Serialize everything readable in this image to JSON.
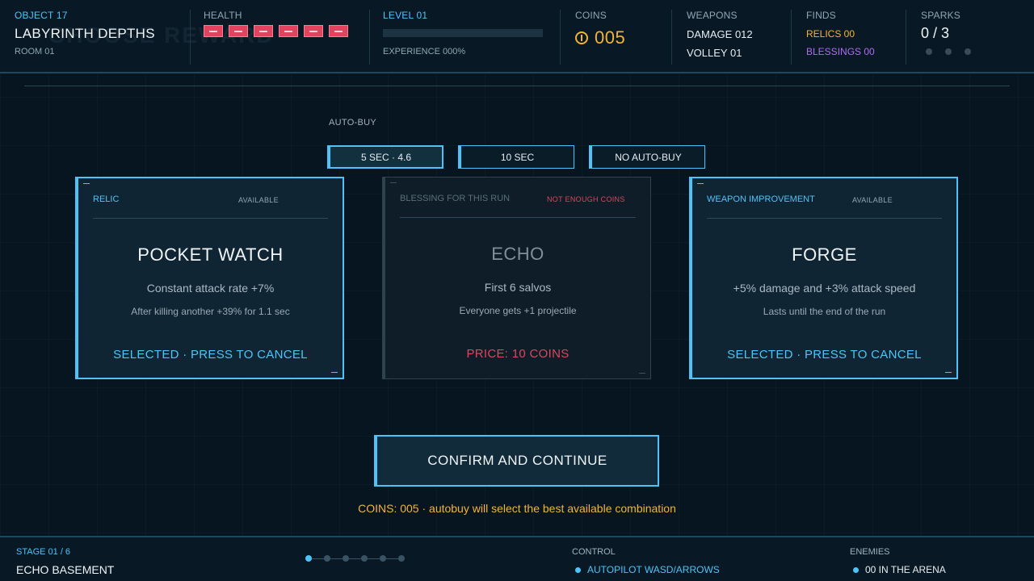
{
  "colors": {
    "accent": "#4fc3f7",
    "coin": "#f5b335",
    "danger": "#e0445e",
    "blessing": "#b06cf0",
    "background": "#071520"
  },
  "hud": {
    "object": {
      "label": "OBJECT 17",
      "title": "LABYRINTH DEPTHS",
      "room": "ROOM 01"
    },
    "health": {
      "label": "HEALTH",
      "pips": 6,
      "icon": "health-pip-icon"
    },
    "level": {
      "label": "LEVEL 01",
      "xp_fraction": 0.0,
      "xp_label": "EXPERIENCE 000%"
    },
    "coins": {
      "label": "COINS",
      "value": "005",
      "icon": "coin-icon"
    },
    "weapons": {
      "label": "WEAPONS",
      "damage": "DAMAGE 012",
      "volley": "VOLLEY 01"
    },
    "finds": {
      "label": "FINDS",
      "relics": "RELICS 00",
      "blessings": "BLESSINGS 00"
    },
    "sparks": {
      "label": "SPARKS",
      "value": "0 / 3",
      "filled": 0,
      "total": 3
    }
  },
  "autobuy": {
    "label": "AUTO-BUY",
    "options": [
      {
        "label": "5 SEC · 4.6",
        "active": true
      },
      {
        "label": "10 SEC",
        "active": false
      },
      {
        "label": "NO AUTO-BUY",
        "active": false
      }
    ]
  },
  "cards": [
    {
      "type": "RELIC",
      "status": "AVAILABLE",
      "title": "POCKET WATCH",
      "desc1": "Constant attack rate +7%",
      "desc2": "After killing another +39% for 1.1 sec",
      "action": "SELECTED · PRESS TO CANCEL",
      "disabled": false
    },
    {
      "type": "BLESSING FOR THIS RUN",
      "status": "NOT ENOUGH COINS",
      "title": "ECHO",
      "desc1": "First 6 salvos",
      "desc2": "Everyone gets +1 projectile",
      "action": "PRICE: 10 COINS",
      "disabled": true
    },
    {
      "type": "WEAPON IMPROVEMENT",
      "status": "AVAILABLE",
      "title": "FORGE",
      "desc1": "+5% damage and +3% attack speed",
      "desc2": "Lasts until the end of the run",
      "action": "SELECTED · PRESS TO CANCEL",
      "disabled": false
    }
  ],
  "confirm": {
    "label": "CONFIRM AND CONTINUE",
    "hint": "COINS: 005 · autobuy will select the best available combination"
  },
  "footer": {
    "stage_label": "STAGE 01 / 6",
    "stage_name": "ECHO BASEMENT",
    "stage_current": 1,
    "stage_total": 6,
    "control_label": "CONTROL",
    "control_value": "AUTOPILOT WASD/ARROWS",
    "enemies_label": "ENEMIES",
    "enemies_value": "00 IN THE ARENA"
  }
}
